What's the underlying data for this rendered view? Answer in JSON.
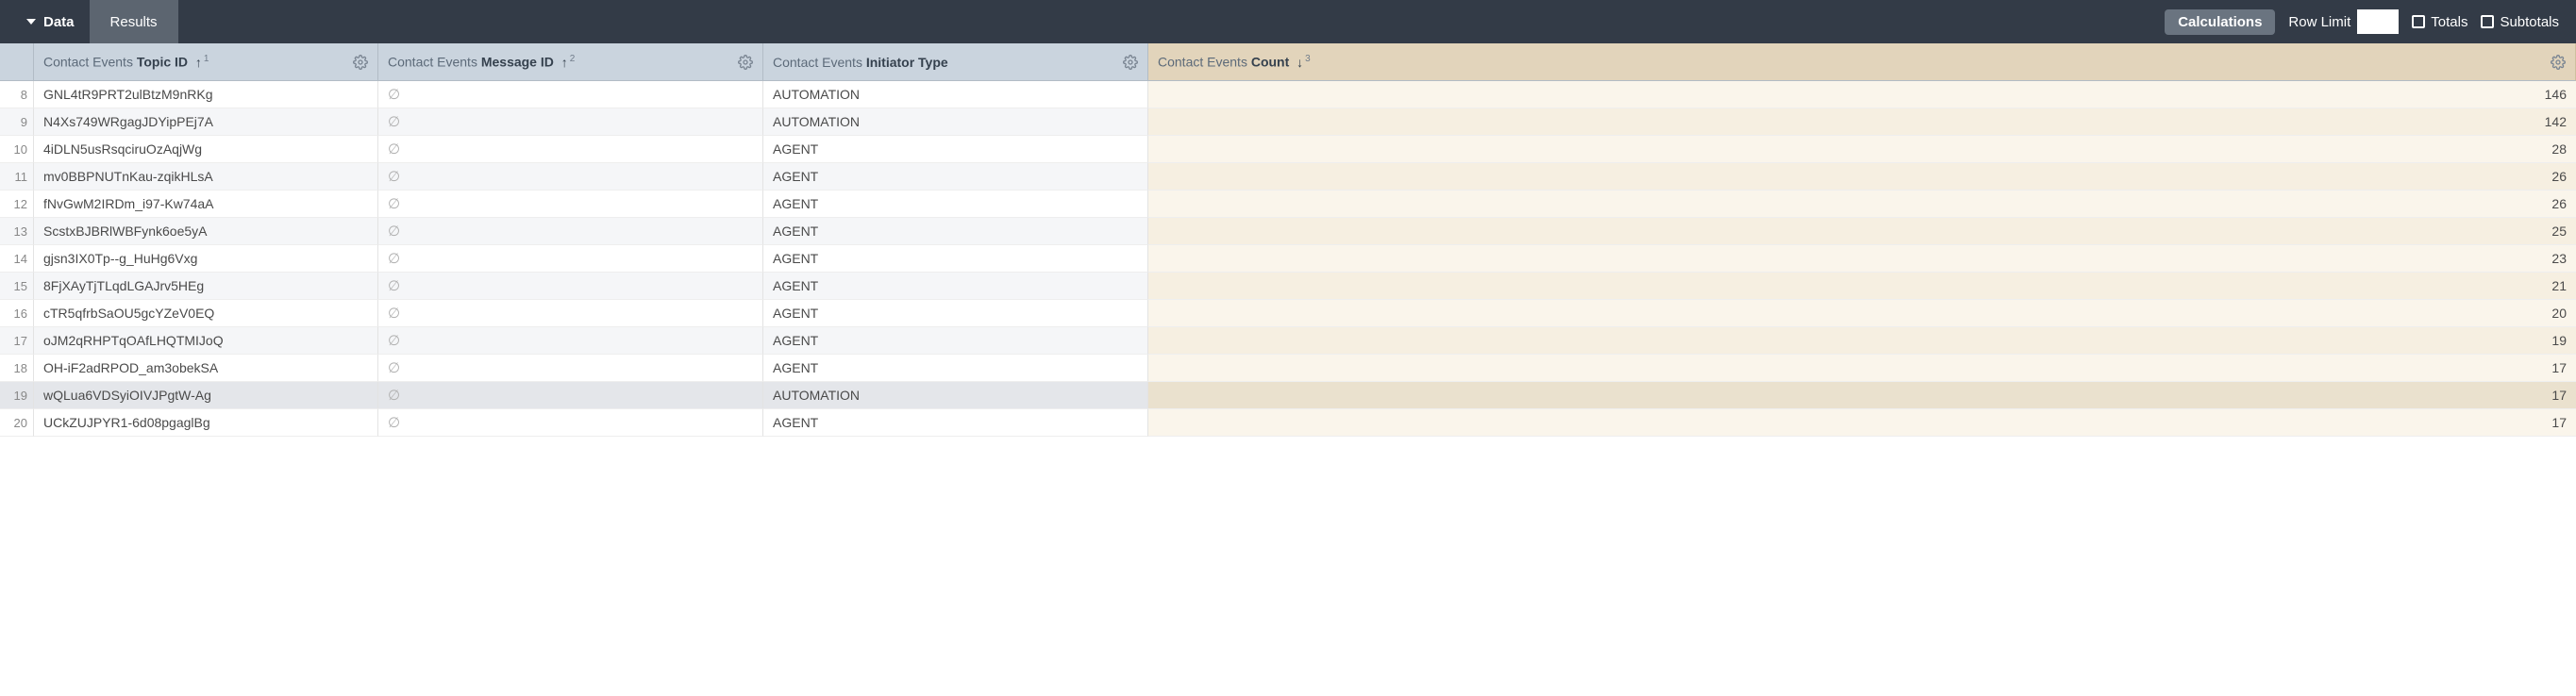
{
  "toolbar": {
    "data_label": "Data",
    "results_tab": "Results",
    "calculations_btn": "Calculations",
    "row_limit_label": "Row Limit",
    "row_limit_value": "",
    "totals_label": "Totals",
    "subtotals_label": "Subtotals"
  },
  "columns": [
    {
      "dim": "Contact Events ",
      "field": "Topic ID",
      "sort_arrow": "↑",
      "sort_order": "1",
      "type": "dimension"
    },
    {
      "dim": "Contact Events ",
      "field": "Message ID",
      "sort_arrow": "↑",
      "sort_order": "2",
      "type": "dimension"
    },
    {
      "dim": "Contact Events ",
      "field": "Initiator Type",
      "sort_arrow": "",
      "sort_order": "",
      "type": "dimension"
    },
    {
      "dim": "Contact Events ",
      "field": "Count",
      "sort_arrow": "↓",
      "sort_order": "3",
      "type": "measure"
    }
  ],
  "null_symbol": "∅",
  "rows": [
    {
      "n": 8,
      "topic": "GNL4tR9PRT2ulBtzM9nRKg",
      "msg": null,
      "init": "AUTOMATION",
      "count": 146
    },
    {
      "n": 9,
      "topic": "N4Xs749WRgagJDYipPEj7A",
      "msg": null,
      "init": "AUTOMATION",
      "count": 142
    },
    {
      "n": 10,
      "topic": "4iDLN5usRsqciruOzAqjWg",
      "msg": null,
      "init": "AGENT",
      "count": 28
    },
    {
      "n": 11,
      "topic": "mv0BBPNUTnKau-zqikHLsA",
      "msg": null,
      "init": "AGENT",
      "count": 26
    },
    {
      "n": 12,
      "topic": "fNvGwM2IRDm_i97-Kw74aA",
      "msg": null,
      "init": "AGENT",
      "count": 26
    },
    {
      "n": 13,
      "topic": "ScstxBJBRlWBFynk6oe5yA",
      "msg": null,
      "init": "AGENT",
      "count": 25
    },
    {
      "n": 14,
      "topic": "gjsn3IX0Tp--g_HuHg6Vxg",
      "msg": null,
      "init": "AGENT",
      "count": 23
    },
    {
      "n": 15,
      "topic": "8FjXAyTjTLqdLGAJrv5HEg",
      "msg": null,
      "init": "AGENT",
      "count": 21
    },
    {
      "n": 16,
      "topic": "cTR5qfrbSaOU5gcYZeV0EQ",
      "msg": null,
      "init": "AGENT",
      "count": 20
    },
    {
      "n": 17,
      "topic": "oJM2qRHPTqOAfLHQTMIJoQ",
      "msg": null,
      "init": "AGENT",
      "count": 19
    },
    {
      "n": 18,
      "topic": "OH-iF2adRPOD_am3obekSA",
      "msg": null,
      "init": "AGENT",
      "count": 17
    },
    {
      "n": 19,
      "topic": "wQLua6VDSyiOIVJPgtW-Ag",
      "msg": null,
      "init": "AUTOMATION",
      "count": 17,
      "hover": true
    },
    {
      "n": 20,
      "topic": "UCkZUJPYR1-6d08pgaglBg",
      "msg": null,
      "init": "AGENT",
      "count": 17
    }
  ]
}
